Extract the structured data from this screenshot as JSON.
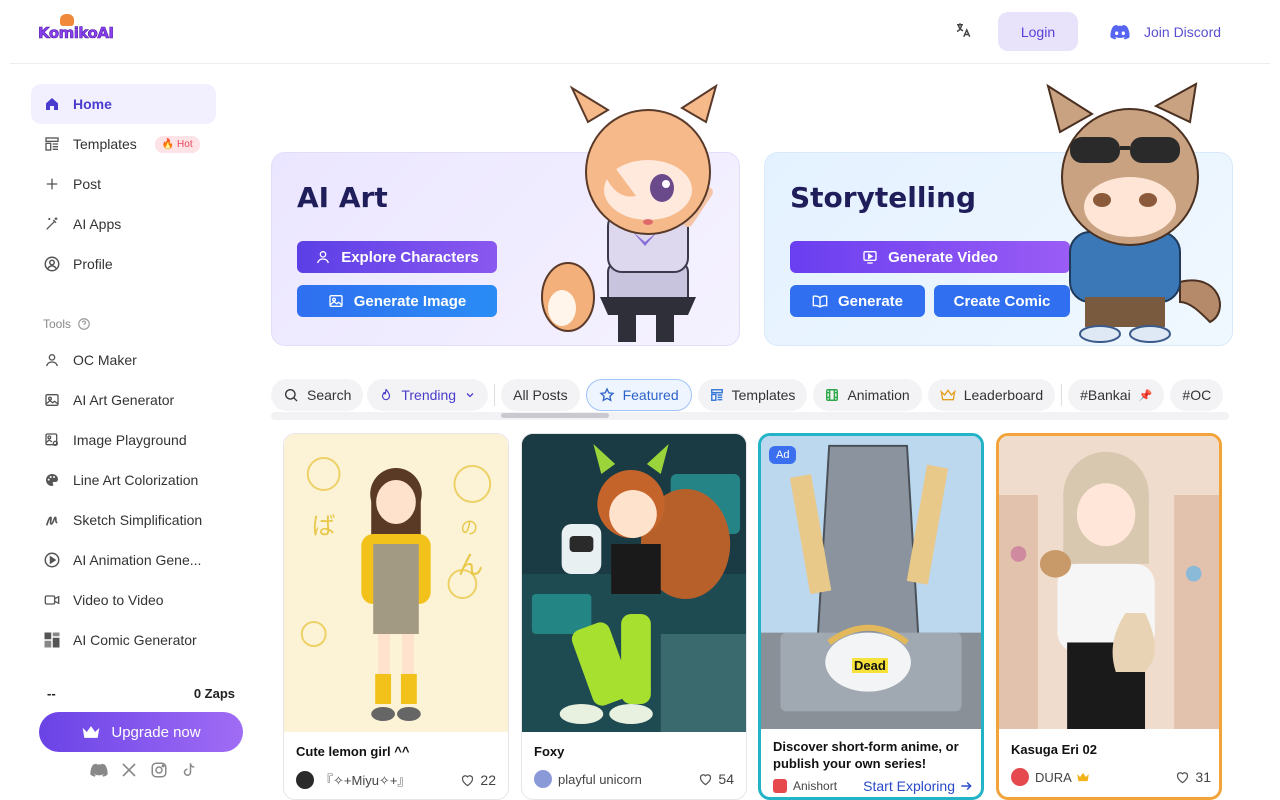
{
  "header": {
    "logo_text": "KomikoAI",
    "translate_icon": "translate-icon",
    "login_label": "Login",
    "discord_label": "Join Discord"
  },
  "sidebar": {
    "nav": [
      {
        "label": "Home",
        "icon": "home-icon",
        "active": true
      },
      {
        "label": "Templates",
        "icon": "templates-icon",
        "badge": "Hot"
      },
      {
        "label": "Post",
        "icon": "plus-icon"
      },
      {
        "label": "AI Apps",
        "icon": "magic-wand-icon"
      },
      {
        "label": "Profile",
        "icon": "profile-icon"
      }
    ],
    "tools_label": "Tools",
    "tools": [
      {
        "label": "OC Maker",
        "icon": "user-icon"
      },
      {
        "label": "AI Art Generator",
        "icon": "image-icon"
      },
      {
        "label": "Image Playground",
        "icon": "image-playground-icon"
      },
      {
        "label": "Line Art Colorization",
        "icon": "palette-icon"
      },
      {
        "label": "Sketch Simplification",
        "icon": "sketch-icon"
      },
      {
        "label": "AI Animation Gene...",
        "icon": "play-icon"
      },
      {
        "label": "Video to Video",
        "icon": "video-icon"
      },
      {
        "label": "AI Comic Generator",
        "icon": "comic-grid-icon"
      }
    ],
    "zaps_left": "--",
    "zaps_right": "0 Zaps",
    "upgrade_label": "Upgrade now"
  },
  "hero": {
    "ai_art": {
      "title": "AI Art",
      "explore_label": "Explore Characters",
      "generate_image_label": "Generate Image"
    },
    "storytelling": {
      "title": "Storytelling",
      "generate_video_label": "Generate Video",
      "generate_label": "Generate",
      "create_comic_label": "Create Comic"
    }
  },
  "filters": {
    "search": "Search",
    "trending": "Trending",
    "all_posts": "All Posts",
    "featured": "Featured",
    "templates": "Templates",
    "animation": "Animation",
    "leaderboard": "Leaderboard",
    "tag1": "#Bankai",
    "tag2": "#OC"
  },
  "cards": [
    {
      "title": "Cute lemon girl ^^",
      "author": "『✧+Miyu✧+』",
      "likes": "22"
    },
    {
      "title": "Foxy",
      "author": "playful unicorn",
      "likes": "54"
    },
    {
      "ad_badge": "Ad",
      "image_text": "Dead",
      "title": "Discover short-form anime, or publish your own series!",
      "source": "Anishort",
      "cta": "Start Exploring"
    },
    {
      "title": "Kasuga Eri 02",
      "author": "DURA",
      "likes": "31"
    }
  ],
  "colors": {
    "accent": "#5b3fe6",
    "blue": "#2f6ff0",
    "ad_border": "#22b3c6",
    "gold_border": "#f2a33a"
  }
}
